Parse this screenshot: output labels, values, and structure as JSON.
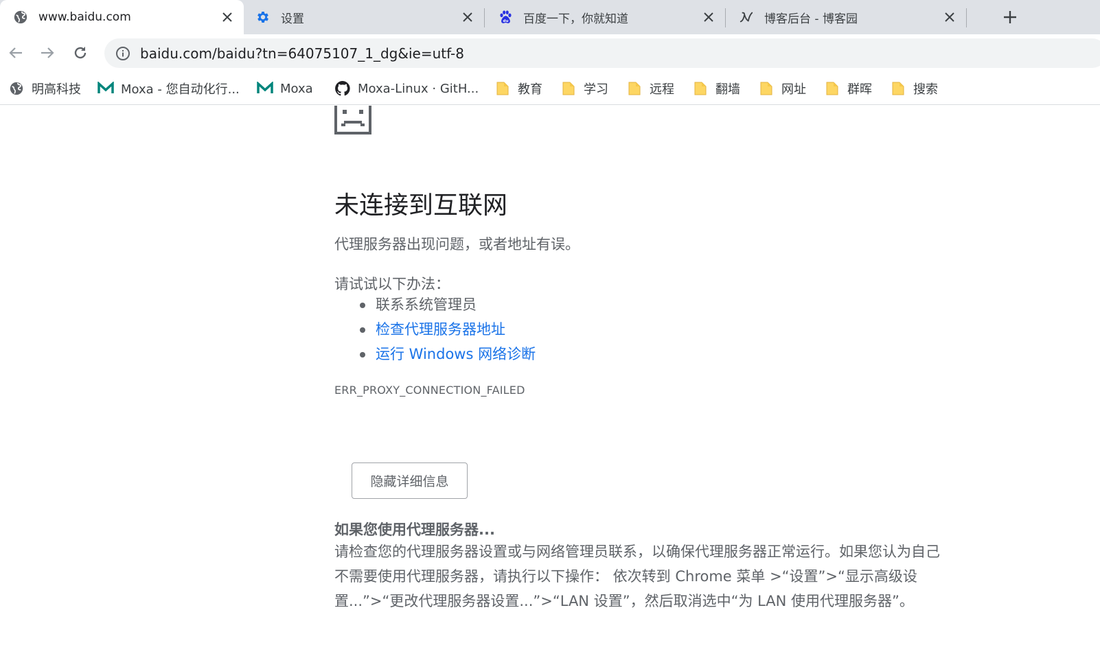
{
  "tabs": [
    {
      "title": "www.baidu.com",
      "icon": "globe-icon",
      "active": true
    },
    {
      "title": "设置",
      "icon": "gear-icon",
      "active": false
    },
    {
      "title": "百度一下，你就知道",
      "icon": "baidu-paw-icon",
      "active": false
    },
    {
      "title": "博客后台 - 博客园",
      "icon": "cnblogs-icon",
      "active": false
    }
  ],
  "toolbar": {
    "url": "baidu.com/baidu?tn=64075107_1_dg&ie=utf-8"
  },
  "bookmarks": [
    {
      "label": "明高科技",
      "icon": "globe-icon"
    },
    {
      "label": "Moxa - 您自动化行...",
      "icon": "moxa-logo-icon"
    },
    {
      "label": "Moxa",
      "icon": "moxa-logo-icon"
    },
    {
      "label": "Moxa-Linux · GitH...",
      "icon": "github-icon"
    },
    {
      "label": "教育",
      "icon": "folder-icon"
    },
    {
      "label": "学习",
      "icon": "folder-icon"
    },
    {
      "label": "远程",
      "icon": "folder-icon"
    },
    {
      "label": "翻墙",
      "icon": "folder-icon"
    },
    {
      "label": "网址",
      "icon": "folder-icon"
    },
    {
      "label": "群晖",
      "icon": "folder-icon"
    },
    {
      "label": "搜索",
      "icon": "folder-icon"
    }
  ],
  "error": {
    "heading": "未连接到互联网",
    "subtitle": "代理服务器出现问题，或者地址有误。",
    "try_label": "请试试以下办法：",
    "suggestions": [
      {
        "text": "联系系统管理员",
        "link": false
      },
      {
        "text": "检查代理服务器地址",
        "link": true
      },
      {
        "text": "运行 Windows 网络诊断",
        "link": true
      }
    ],
    "code": "ERR_PROXY_CONNECTION_FAILED",
    "details_button": "隐藏详细信息",
    "details_heading": "如果您使用代理服务器...",
    "details_body": "请检查您的代理服务器设置或与网络管理员联系，以确保代理服务器正常运行。如果您认为自己不需要使用代理服务器，请执行以下操作： 依次转到 Chrome 菜单 >“设置”>“显示高级设置...”>“更改代理服务器设置...”>“LAN 设置”，然后取消选中“为 LAN 使用代理服务器”。"
  },
  "colors": {
    "tabstrip": "#dee1e6",
    "link": "#1a73e8",
    "text_secondary": "#5f6368",
    "folder": "#fdd663",
    "moxa": "#00857c",
    "settings_gear": "#1a73e8",
    "baidu": "#2932e1"
  }
}
